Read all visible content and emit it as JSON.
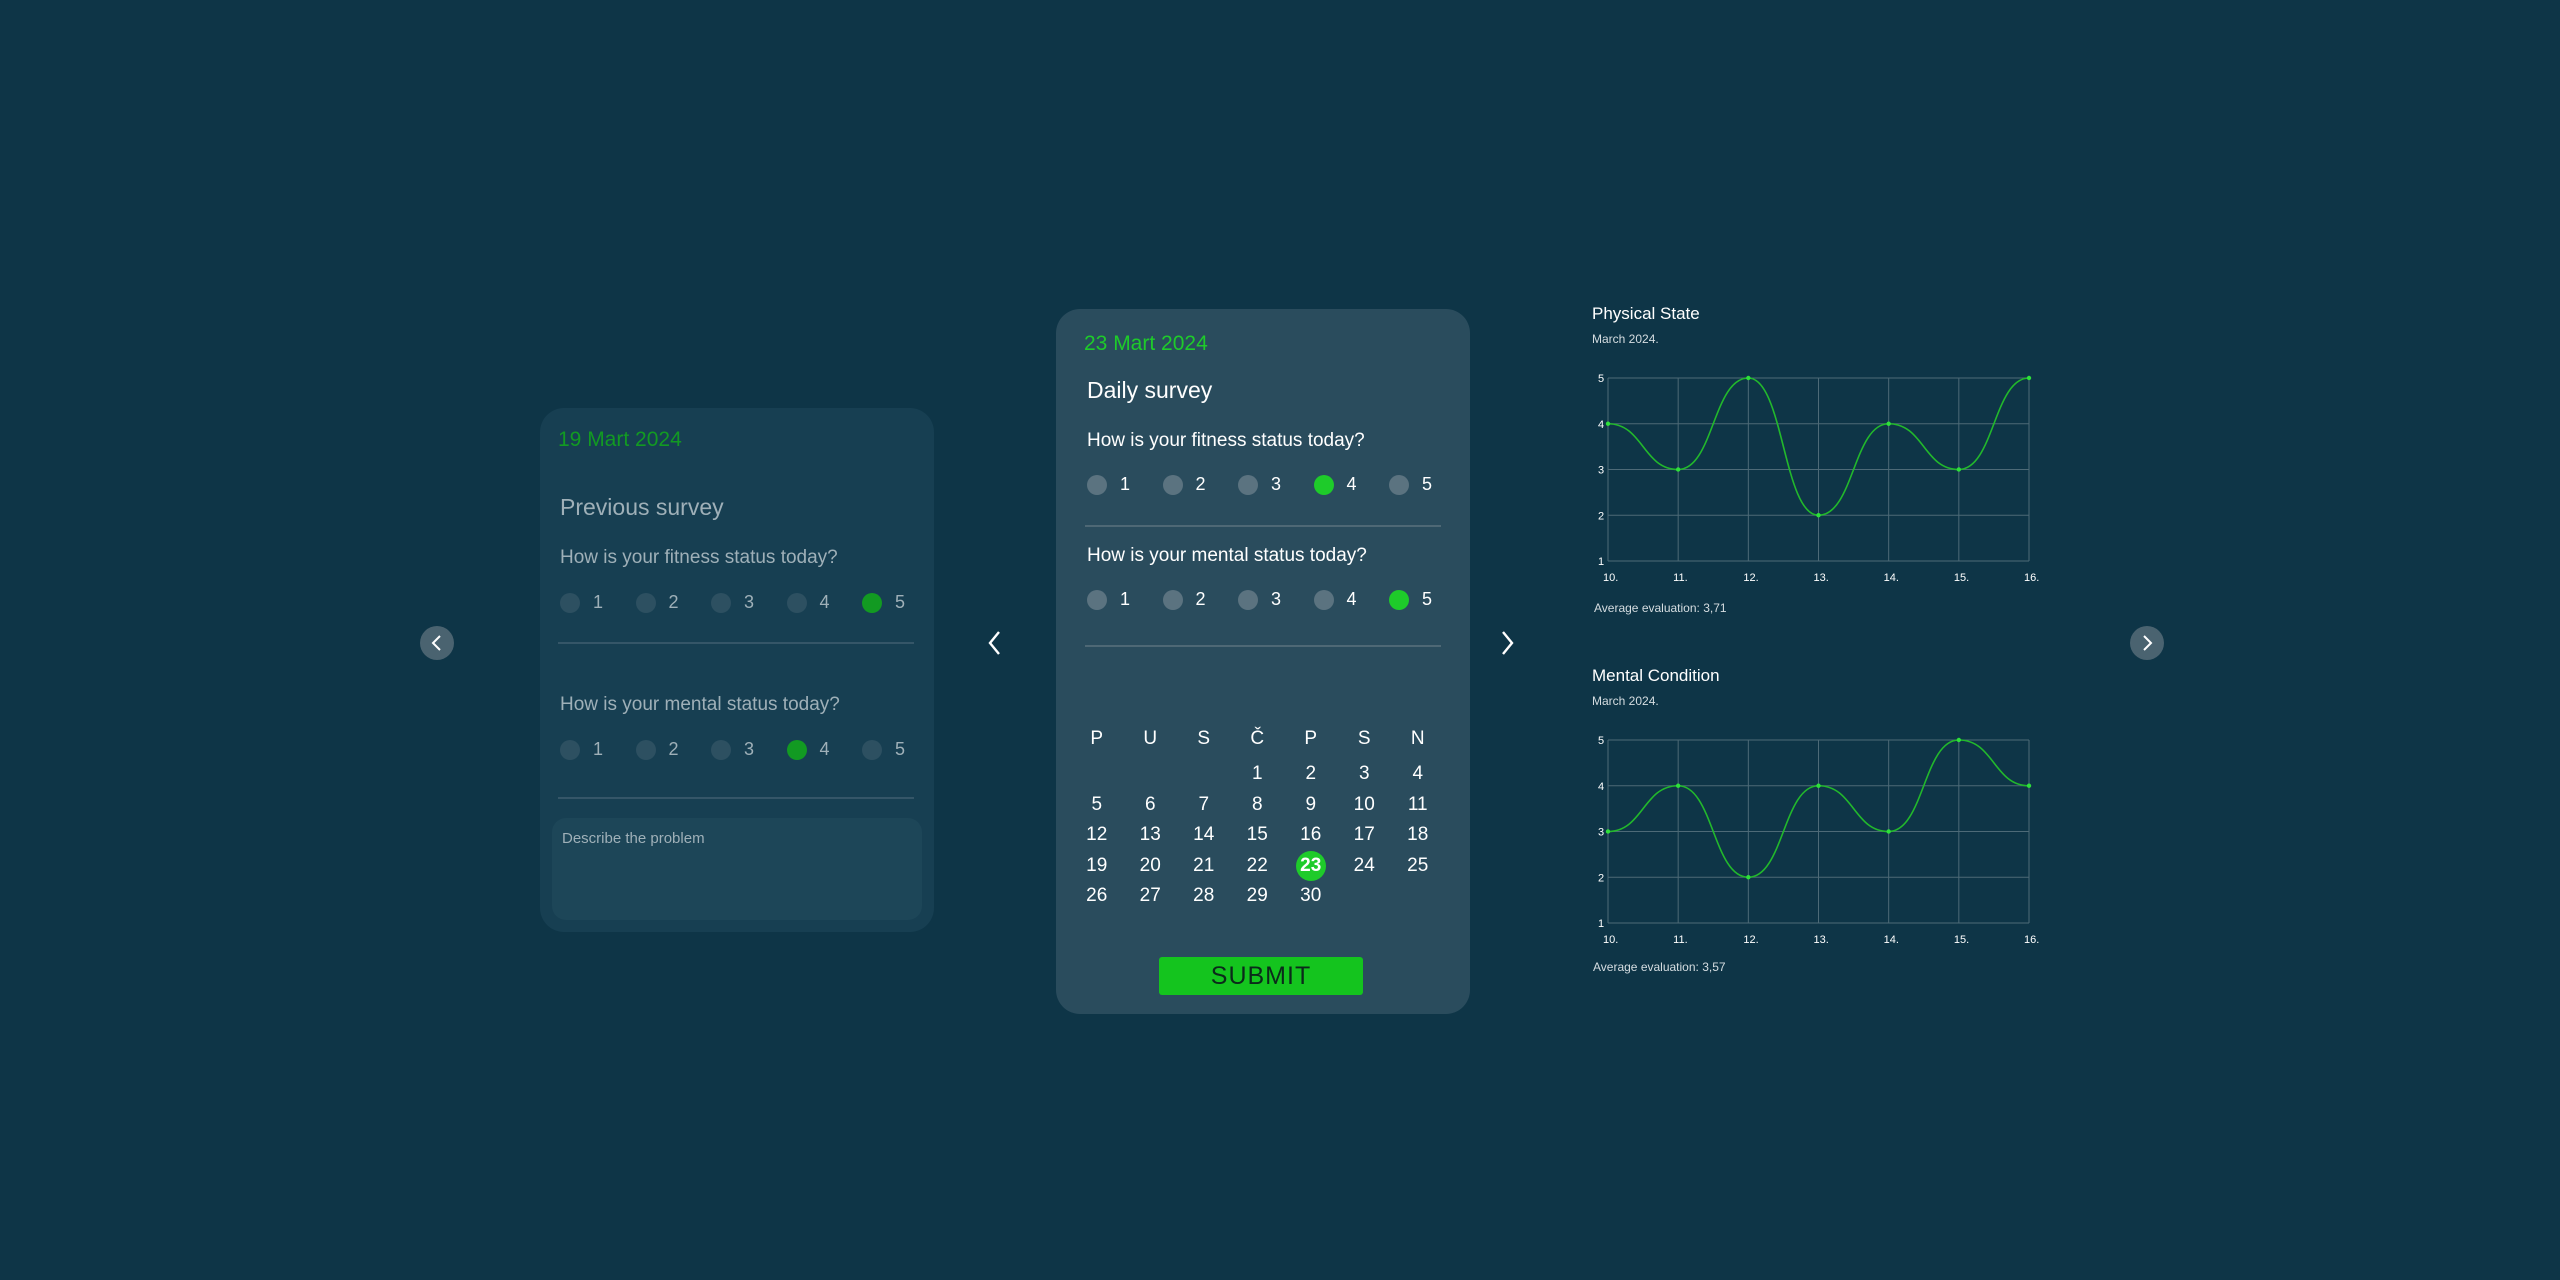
{
  "previous_card": {
    "date": "19 Mart 2024",
    "title": "Previous survey",
    "q_fitness": "How is your fitness status today?",
    "q_mental": "How is your mental status today?",
    "options": [
      "1",
      "2",
      "3",
      "4",
      "5"
    ],
    "fitness_selected": 5,
    "mental_selected": 4,
    "problem_placeholder": "Describe the problem"
  },
  "main_card": {
    "date": "23 Mart 2024",
    "title": "Daily survey",
    "q_fitness": "How is your fitness status today?",
    "q_mental": "How is your mental status today?",
    "options": [
      "1",
      "2",
      "3",
      "4",
      "5"
    ],
    "fitness_selected": 4,
    "mental_selected": 5,
    "calendar": {
      "weekdays": [
        "P",
        "U",
        "S",
        "Č",
        "P",
        "S",
        "N"
      ],
      "start_offset": 3,
      "days": 30,
      "today": 23
    },
    "submit_label": "SUBMIT"
  },
  "nav": {
    "left_icon": "chevron-left-icon",
    "right_icon": "chevron-right-icon"
  },
  "colors": {
    "background": "#0e3547",
    "accent": "#1ecb2a",
    "line": "#22b82c"
  },
  "chart_data": [
    {
      "type": "line",
      "title": "Physical State",
      "subtitle": "March 2024.",
      "x": [
        "10.",
        "11.",
        "12.",
        "13.",
        "14.",
        "15.",
        "16."
      ],
      "values": [
        4,
        3,
        5,
        2,
        4,
        3,
        5
      ],
      "ylim": [
        1,
        5
      ],
      "yticks": [
        1,
        2,
        3,
        4,
        5
      ],
      "grid": true,
      "average_label": "Average evaluation: 3,71"
    },
    {
      "type": "line",
      "title": "Mental Condition",
      "subtitle": "March 2024.",
      "x": [
        "10.",
        "11.",
        "12.",
        "13.",
        "14.",
        "15.",
        "16."
      ],
      "values": [
        3,
        4,
        2,
        4,
        3,
        5,
        4
      ],
      "ylim": [
        1,
        5
      ],
      "yticks": [
        1,
        2,
        3,
        4,
        5
      ],
      "grid": true,
      "average_label": "Average evaluation: 3,57"
    }
  ]
}
